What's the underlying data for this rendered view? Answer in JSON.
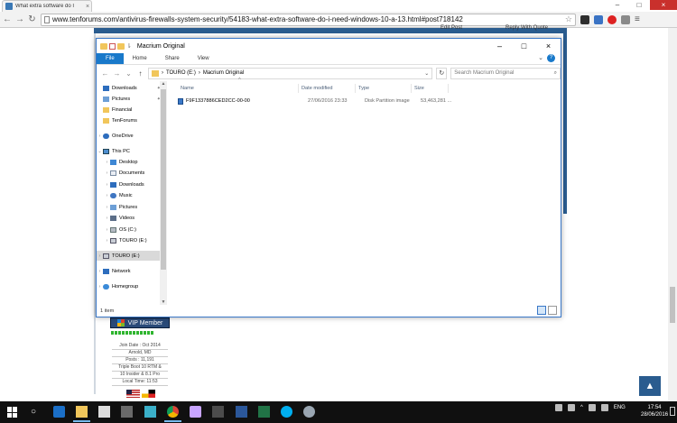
{
  "browser": {
    "tab_title": "What extra software do I",
    "url": "www.tenforums.com/antivirus-firewalls-system-security/54183-what-extra-software-do-i-need-windows-10-a-13.html#post718142"
  },
  "page": {
    "edit_post": "Edit Post",
    "reply_quote": "Reply With Quote",
    "badge": "VIP Member",
    "profile": [
      "Join Date : Oct 2014",
      "Arnold, MD",
      "Posts : 11,191",
      "Triple Boot 10 RTM &",
      "10 Insider & 8.1 Pro",
      "Local Time: 11:53"
    ]
  },
  "explorer": {
    "title": "Macrium Original",
    "ribbon_tabs": [
      "File",
      "Home",
      "Share",
      "View"
    ],
    "breadcrumb": [
      "TOURO (E:)",
      "Macrium Original"
    ],
    "search_placeholder": "Search Macrium Original",
    "nav": {
      "downloads": "Downloads",
      "pictures": "Pictures",
      "financial": "Financial",
      "tenforums": "TenForums",
      "onedrive": "OneDrive",
      "this_pc": "This PC",
      "desktop": "Desktop",
      "documents": "Documents",
      "downloads2": "Downloads",
      "music": "Music",
      "pictures2": "Pictures",
      "videos": "Videos",
      "os": "OS (C:)",
      "touro": "TOURO (E:)",
      "touro2": "TOURO (E:)",
      "network": "Network",
      "homegroup": "Homegroup"
    },
    "columns": {
      "name": "Name",
      "date": "Date modified",
      "type": "Type",
      "size": "Size"
    },
    "files": [
      {
        "name": "F9F1337886CED2CC-00-00",
        "date": "27/06/2016 23:33",
        "type": "Disk Partition image",
        "size": "53,463,281 ..."
      }
    ],
    "status": "1 item"
  },
  "taskbar": {
    "lang": "ENG",
    "time": "17:54",
    "date": "28/06/2016"
  },
  "colors": {
    "explorer_accent": "#1979ca",
    "forum_blue": "#2a5c8f",
    "taskbar": "#101010"
  }
}
